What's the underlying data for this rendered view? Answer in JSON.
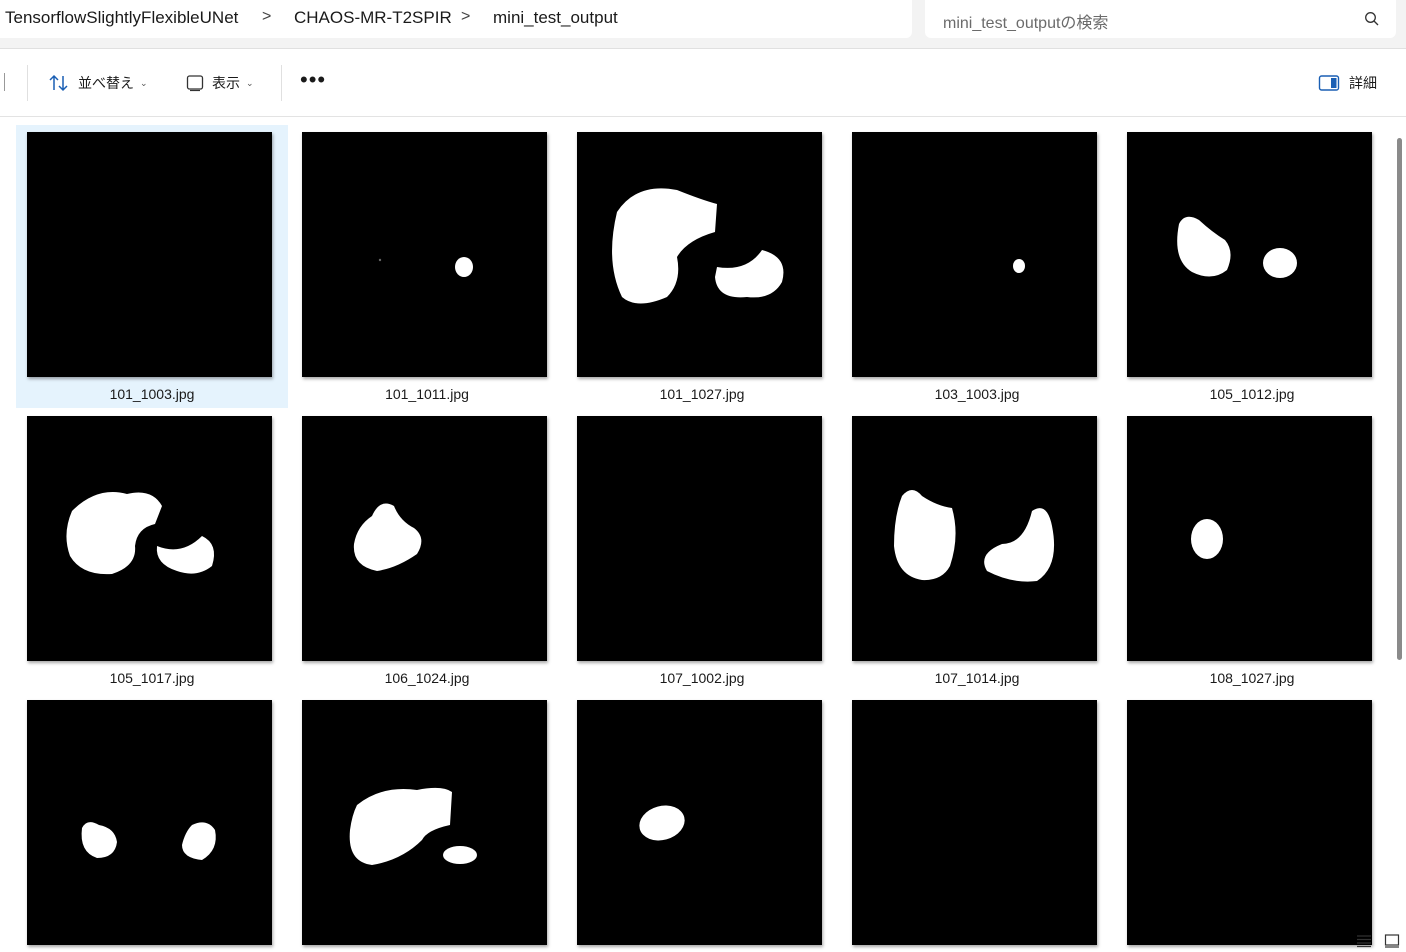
{
  "address_bar": {
    "breadcrumbs": [
      "TensorflowSlightlyFlexibleUNet",
      "CHAOS-MR-T2SPIR",
      "mini_test_output"
    ],
    "separator": ">"
  },
  "search": {
    "placeholder": "mini_test_outputの検索",
    "icon": "search-icon"
  },
  "command_bar": {
    "sort_label": "並べ替え",
    "view_label": "表示",
    "more_label": "•••",
    "details_label": "詳細"
  },
  "files": [
    {
      "name": "101_1003.jpg",
      "selected": true
    },
    {
      "name": "101_1011.jpg"
    },
    {
      "name": "101_1027.jpg"
    },
    {
      "name": "103_1003.jpg"
    },
    {
      "name": "105_1012.jpg"
    },
    {
      "name": "105_1017.jpg"
    },
    {
      "name": "106_1024.jpg"
    },
    {
      "name": "107_1002.jpg"
    },
    {
      "name": "107_1014.jpg"
    },
    {
      "name": "108_1027.jpg"
    },
    {
      "name": ""
    },
    {
      "name": ""
    },
    {
      "name": ""
    },
    {
      "name": ""
    },
    {
      "name": ""
    }
  ],
  "colors": {
    "selection": "#e5f3fd",
    "accent": "#0067c0"
  }
}
